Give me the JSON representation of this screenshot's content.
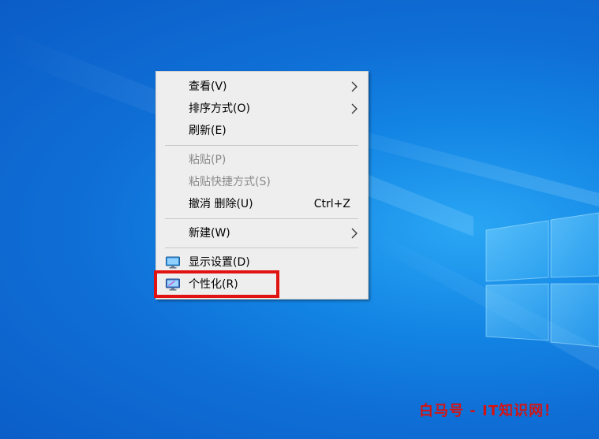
{
  "context_menu": {
    "items": [
      {
        "label": "查看(V)",
        "icon": null,
        "shortcut": null,
        "submenu": true,
        "disabled": false
      },
      {
        "label": "排序方式(O)",
        "icon": null,
        "shortcut": null,
        "submenu": true,
        "disabled": false
      },
      {
        "label": "刷新(E)",
        "icon": null,
        "shortcut": null,
        "submenu": false,
        "disabled": false
      },
      {
        "label": "粘贴(P)",
        "icon": null,
        "shortcut": null,
        "submenu": false,
        "disabled": true
      },
      {
        "label": "粘贴快捷方式(S)",
        "icon": null,
        "shortcut": null,
        "submenu": false,
        "disabled": true
      },
      {
        "label": "撤消 删除(U)",
        "icon": null,
        "shortcut": "Ctrl+Z",
        "submenu": false,
        "disabled": false
      },
      {
        "label": "新建(W)",
        "icon": null,
        "shortcut": null,
        "submenu": true,
        "disabled": false
      },
      {
        "label": "显示设置(D)",
        "icon": "display-settings-icon",
        "shortcut": null,
        "submenu": false,
        "disabled": false
      },
      {
        "label": "个性化(R)",
        "icon": "personalize-icon",
        "shortcut": null,
        "submenu": false,
        "disabled": false
      }
    ]
  },
  "highlight": {
    "target": "个性化(R)",
    "color": "#e01212"
  },
  "watermark": {
    "text": "白马号 - IT知识网！"
  },
  "colors": {
    "desktop_blue": "#0f6fd6",
    "menu_background": "#eeeeee",
    "disabled_text": "#8a8a8a",
    "highlight_red": "#e01212",
    "watermark_red": "#d31313"
  }
}
